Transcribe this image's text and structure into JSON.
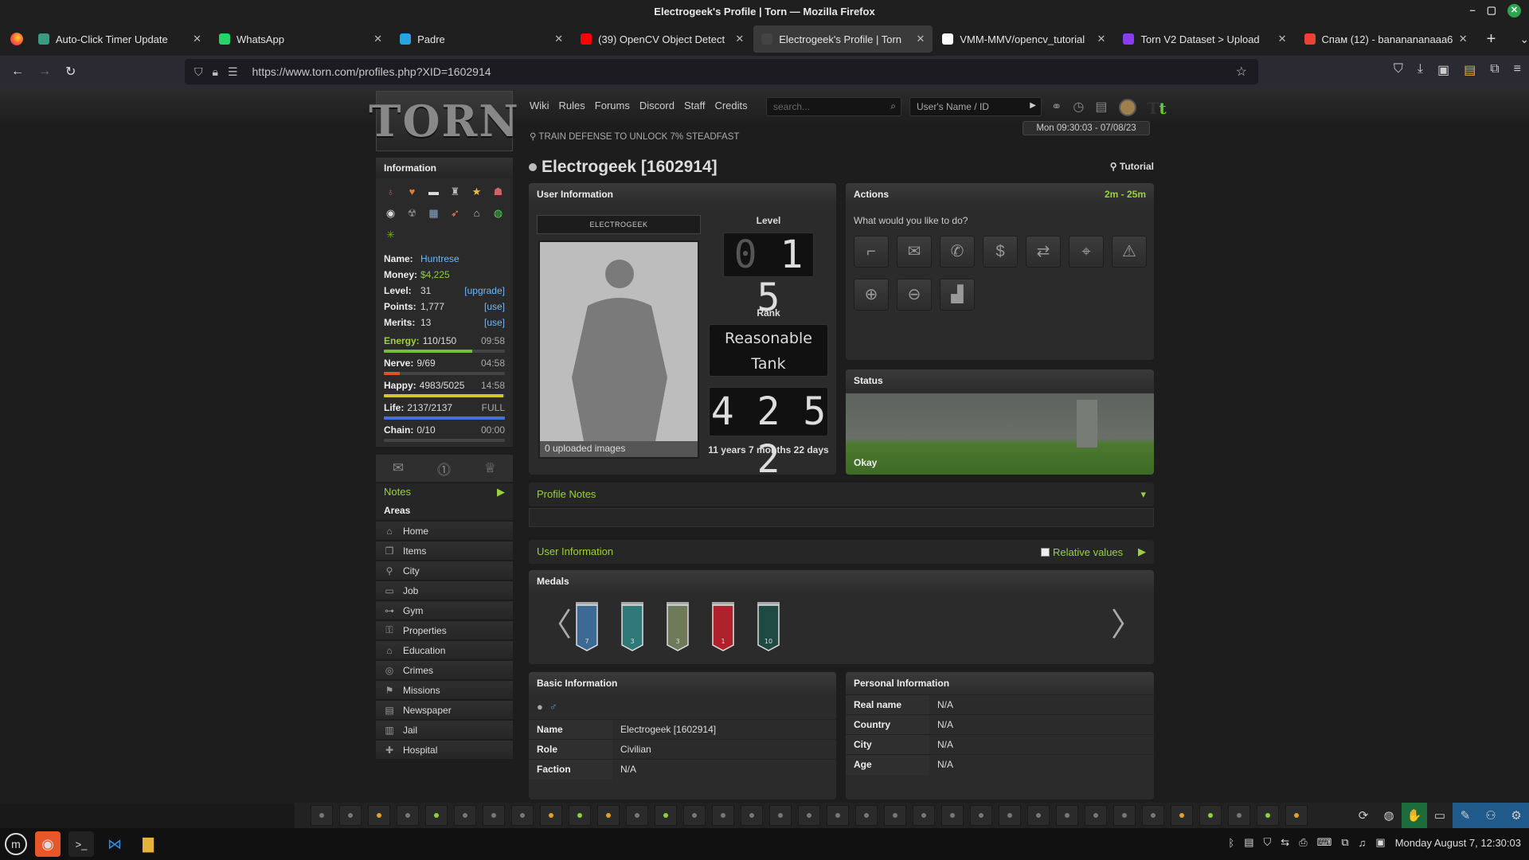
{
  "window": {
    "title": "Electrogeek's Profile | Torn — Mozilla Firefox"
  },
  "tabs": [
    {
      "label": "Auto-Click Timer Update",
      "icon": "openai-icon",
      "color": "#3a9a82"
    },
    {
      "label": "WhatsApp",
      "icon": "whatsapp-icon",
      "color": "#25d366"
    },
    {
      "label": "Padre",
      "icon": "telegram-icon",
      "color": "#2aa3df"
    },
    {
      "label": "(39) OpenCV Object Detect",
      "icon": "youtube-icon",
      "color": "#ff0000"
    },
    {
      "label": "Electrogeek's Profile | Torn",
      "icon": "torn-icon",
      "color": "#444444",
      "active": true
    },
    {
      "label": "VMM-MMV/opencv_tutorial",
      "icon": "github-icon",
      "color": "#ffffff"
    },
    {
      "label": "Torn V2 Dataset > Upload",
      "icon": "roboflow-icon",
      "color": "#8a3cf0"
    },
    {
      "label": "Спам (12) - bananananaaa6",
      "icon": "gmail-icon",
      "color": "#ea4335"
    }
  ],
  "url": "https://www.torn.com/profiles.php?XID=1602914",
  "header": {
    "logo": "TORN",
    "nav": [
      "Wiki",
      "Rules",
      "Forums",
      "Discord",
      "Staff",
      "Credits"
    ],
    "search_placeholder": "search...",
    "user_select": "User's Name / ID",
    "datetime": "Mon 09:30:03 - 07/08/23",
    "train_msg": "TRAIN DEFENSE TO UNLOCK 7% STEADFAST"
  },
  "sidebar": {
    "info_title": "Information",
    "name_label": "Name:",
    "name": "Huntrese",
    "money_label": "Money:",
    "money": "$4,225",
    "level_label": "Level:",
    "level": "31",
    "level_link": "[upgrade]",
    "points_label": "Points:",
    "points": "1,777",
    "points_link": "[use]",
    "merits_label": "Merits:",
    "merits": "13",
    "merits_link": "[use]",
    "bars": [
      {
        "label": "Energy:",
        "value": "110/150",
        "time": "09:58",
        "fraction": 0.73,
        "color": "#6ec13a",
        "label_color": "#9ad13c"
      },
      {
        "label": "Nerve:",
        "value": "9/69",
        "time": "04:58",
        "fraction": 0.13,
        "color": "#d9532c",
        "label_color": "#eeeeee"
      },
      {
        "label": "Happy:",
        "value": "4983/5025",
        "time": "14:58",
        "fraction": 0.99,
        "color": "#d8c52b",
        "label_color": "#eeeeee"
      },
      {
        "label": "Life:",
        "value": "2137/2137",
        "time": "FULL",
        "fraction": 1.0,
        "color": "#4a6de0",
        "label_color": "#eeeeee"
      },
      {
        "label": "Chain:",
        "value": "0/10",
        "time": "00:00",
        "fraction": 0.0,
        "color": "#888888",
        "label_color": "#eeeeee"
      }
    ],
    "notes": "Notes",
    "areas_title": "Areas",
    "areas": [
      {
        "label": "Home",
        "icon": "home-icon"
      },
      {
        "label": "Items",
        "icon": "items-icon"
      },
      {
        "label": "City",
        "icon": "city-pin-icon"
      },
      {
        "label": "Job",
        "icon": "briefcase-icon"
      },
      {
        "label": "Gym",
        "icon": "dumbbell-icon"
      },
      {
        "label": "Properties",
        "icon": "key-icon"
      },
      {
        "label": "Education",
        "icon": "mortarboard-icon"
      },
      {
        "label": "Crimes",
        "icon": "fingerprint-icon"
      },
      {
        "label": "Missions",
        "icon": "missions-icon"
      },
      {
        "label": "Newspaper",
        "icon": "newspaper-icon"
      },
      {
        "label": "Jail",
        "icon": "jail-icon"
      },
      {
        "label": "Hospital",
        "icon": "hospital-icon"
      }
    ]
  },
  "profile": {
    "title": "Electrogeek [1602914]",
    "tutorial": "Tutorial",
    "user_info_title": "User Information",
    "name_strip": "ELECTROGEEK",
    "images_caption": "0 uploaded images",
    "level_title": "Level",
    "level_digits": [
      "0",
      "1",
      "5"
    ],
    "rank_title": "Rank",
    "rank_line1": "Reasonable",
    "rank_line2": "Tank",
    "age_digits": [
      "4",
      "2",
      "5",
      "2"
    ],
    "age_text": "11 years 7 months 22 days",
    "actions_title": "Actions",
    "actions_time": "2m - 25m",
    "actions_question": "What would you like to do?",
    "status_title": "Status",
    "status_text": "Okay",
    "profile_notes": "Profile Notes",
    "user_info_section": "User Information",
    "relative_values": "Relative values",
    "medals_title": "Medals",
    "medals": [
      {
        "color": "#3d6a94",
        "num": "7"
      },
      {
        "color": "#2f7a78",
        "num": "3"
      },
      {
        "color": "#6f7a5a",
        "num": "3"
      },
      {
        "color": "#b0222b",
        "num": "1"
      },
      {
        "color": "#1f4a44",
        "num": "10"
      }
    ],
    "basic_title": "Basic Information",
    "basic": [
      {
        "k": "Name",
        "v": "Electrogeek [1602914]"
      },
      {
        "k": "Role",
        "v": "Civilian"
      },
      {
        "k": "Faction",
        "v": "N/A"
      }
    ],
    "personal_title": "Personal Information",
    "personal": [
      {
        "k": "Real name",
        "v": "N/A"
      },
      {
        "k": "Country",
        "v": "N/A"
      },
      {
        "k": "City",
        "v": "N/A"
      },
      {
        "k": "Age",
        "v": "N/A"
      }
    ]
  },
  "taskbar": {
    "clock": "Monday August  7, 12:30:03"
  }
}
